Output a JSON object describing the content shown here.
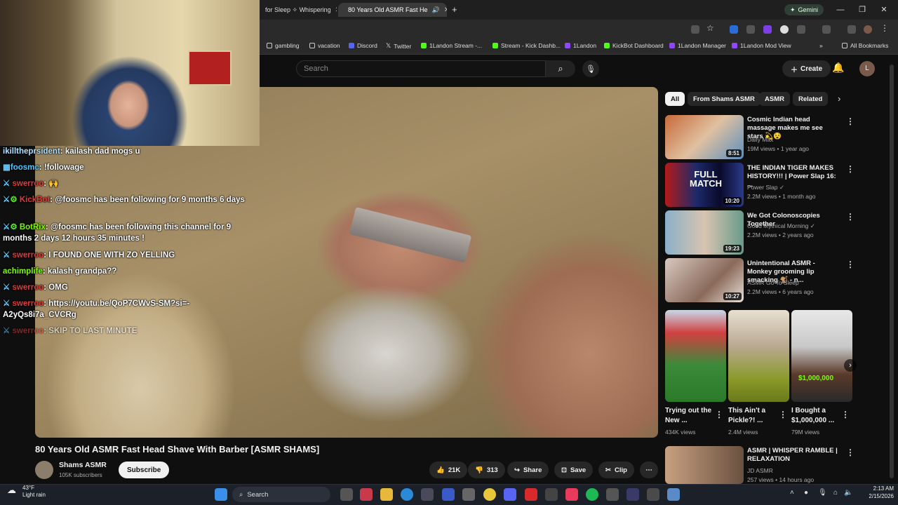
{
  "browser": {
    "tabs": [
      {
        "label": "for Sleep ✧ Whispering"
      },
      {
        "label": "80 Years Old ASMR Fast He"
      }
    ],
    "new_tab": "+",
    "gemini_label": "Gemini",
    "bookmarks": [
      "gambling",
      "vacation",
      "Discord",
      "Twitter",
      "1Landon Stream -...",
      "Stream - Kick Dashb...",
      "1Landon",
      "KickBot Dashboard",
      "1Landon Manager",
      "1Landon Mod View"
    ],
    "all_bookmarks": "All Bookmarks"
  },
  "youtube": {
    "search_placeholder": "Search",
    "create_label": "Create",
    "avatar_letter": "L",
    "video_title": "80 Years Old ASMR Fast Head Shave With Barber [ASMR SHAMS]",
    "channel_name": "Shams ASMR",
    "channel_subs": "105K subscribers",
    "subscribe": "Subscribe",
    "likes": "21K",
    "dislikes": "313",
    "share": "Share",
    "save": "Save",
    "clip": "Clip",
    "chips": [
      "All",
      "From Shams ASMR",
      "ASMR",
      "Related"
    ],
    "recommendations": [
      {
        "title": "Cosmic Indian head massage makes me see stars 💫😵",
        "channel": "Daily Max",
        "meta": "19M views • 1 year ago",
        "duration": "8:51"
      },
      {
        "title": "THE INDIAN TIGER MAKES HISTORY!!! | Power Slap 16: ...",
        "channel": "Power Slap ✓",
        "meta": "2.2M views • 1 month ago",
        "duration": "10:20"
      },
      {
        "title": "We Got Colonoscopies Together",
        "channel": "Good Mythical Morning ✓",
        "meta": "2.2M views • 2 years ago",
        "duration": "19:23"
      },
      {
        "title": "Unintentional ASMR - Monkey grooming lip smacking 🐒 - n...",
        "channel": "ASMR Go To Sleep",
        "meta": "2.2M views • 6 years ago",
        "duration": "10:27"
      }
    ],
    "shorts": [
      {
        "title": "Trying out the New ...",
        "views": "434K views"
      },
      {
        "title": "This Ain't a Pickle?! ...",
        "views": "2.4M views"
      },
      {
        "title": "I Bought a $1,000,000 ...",
        "views": "79M views"
      }
    ],
    "bottom_rec": {
      "title": "ASMR | WHISPER RAMBLE | RELAXATION",
      "channel": "JD ASMR",
      "meta": "257 views • 14 hours ago"
    }
  },
  "chat": [
    {
      "user": "ikilltheprsident",
      "msg": "kailash dad mogs u"
    },
    {
      "user": "foosmc",
      "msg": "!followage"
    },
    {
      "user": "swerroo",
      "msg": "🙌"
    },
    {
      "user": "KickBot",
      "msg": "@foosmc has been following for 9 months 6 days"
    },
    {
      "user": "BotRix",
      "msg": "@foosmc has been following this channel for 9 months 2 days 12 hours 35 minutes !"
    },
    {
      "user": "swerroo",
      "msg": "I FOUND ONE WITH ZO YELLING"
    },
    {
      "user": "achimplife",
      "msg": "kalash grandpa??"
    },
    {
      "user": "swerroo",
      "msg": "OMG"
    },
    {
      "user": "swerroo",
      "msg": "https://youtu.be/QoP7CWvS-SM?si=-A2yQs8i7a_CVCRg"
    },
    {
      "user": "swerroo",
      "msg": "SKIP TO LAST MINUTE"
    }
  ],
  "taskbar": {
    "weather_temp": "43°F",
    "weather_desc": "Light rain",
    "search": "Search",
    "time": "2:13 AM",
    "date": "2/15/2026"
  },
  "colors": {
    "accent": "#ff0000",
    "chat_user": "#4fc3f7",
    "chat_mod": "#e53935"
  }
}
